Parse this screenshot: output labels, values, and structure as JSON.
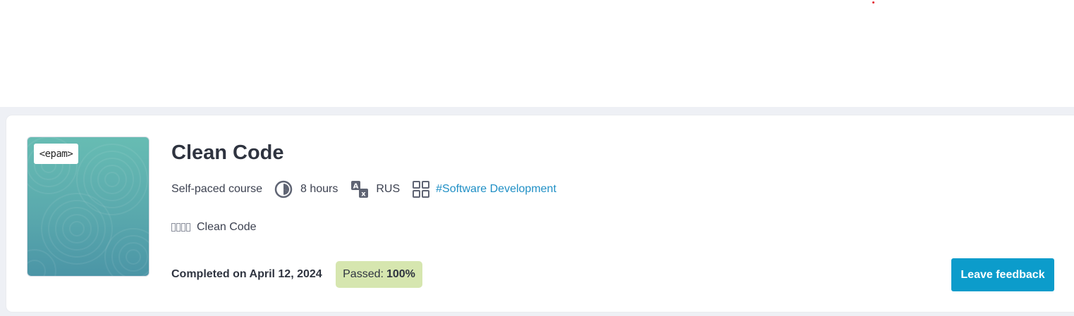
{
  "card": {
    "logo_text": "<epam>",
    "title": "Clean Code",
    "meta": {
      "course_type": "Self-paced course",
      "duration": "8 hours",
      "language": "RUS",
      "tag": "#Software Development"
    },
    "author": {
      "name": "Clean Code"
    },
    "completed_text": "Completed on April 12, 2024",
    "passed_label": "Passed:",
    "passed_value": "100%",
    "feedback_label": "Leave feedback"
  },
  "colors": {
    "accent": "#0c9ccb",
    "link": "#1f8fc5",
    "passed_bg": "#d6e6af",
    "thumb_top": "#67bcb3",
    "thumb_bottom": "#4b95a6"
  },
  "icons": {
    "duration": "clock-icon",
    "language": "translate-icon",
    "tag": "grid-icon"
  }
}
